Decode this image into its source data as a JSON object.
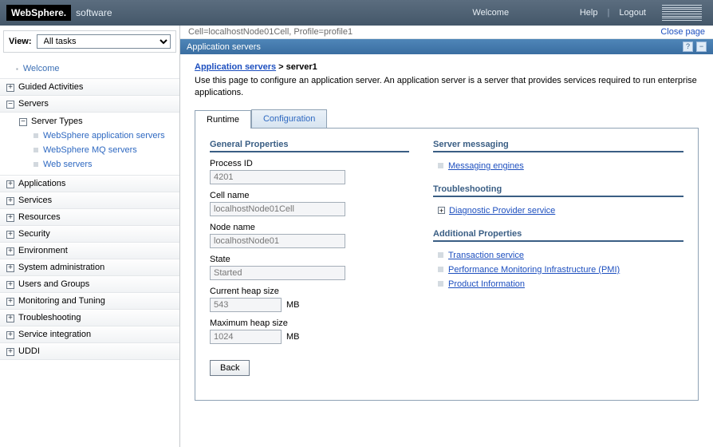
{
  "brand": {
    "strong": "WebSphere.",
    "suffix": "software"
  },
  "top": {
    "welcome": "Welcome",
    "help": "Help",
    "logout": "Logout"
  },
  "view": {
    "label": "View:",
    "value": "All tasks"
  },
  "nav": {
    "welcome": "Welcome",
    "guided": "Guided Activities",
    "servers": "Servers",
    "server_types": "Server Types",
    "was": "WebSphere application servers",
    "mq": "WebSphere MQ servers",
    "web": "Web servers",
    "applications": "Applications",
    "services": "Services",
    "resources": "Resources",
    "security": "Security",
    "environment": "Environment",
    "sysadmin": "System administration",
    "users": "Users and Groups",
    "monitoring": "Monitoring and Tuning",
    "troubleshooting": "Troubleshooting",
    "service_int": "Service integration",
    "uddi": "UDDI"
  },
  "path": "Cell=localhostNode01Cell, Profile=profile1",
  "close": "Close page",
  "panel_title": "Application servers",
  "crumb": {
    "link": "Application servers",
    "sep": " > ",
    "current": "server1"
  },
  "desc": "Use this page to configure an application server. An application server is a server that provides services required to run enterprise applications.",
  "tabs": {
    "runtime": "Runtime",
    "config": "Configuration"
  },
  "gp": {
    "title": "General Properties",
    "pid_l": "Process ID",
    "pid": "4201",
    "cell_l": "Cell name",
    "cell": "localhostNode01Cell",
    "node_l": "Node name",
    "node": "localhostNode01",
    "state_l": "State",
    "state": "Started",
    "cur_l": "Current heap size",
    "cur": "543",
    "max_l": "Maximum heap size",
    "max": "1024",
    "mb": "MB",
    "back": "Back"
  },
  "rs": {
    "msg_t": "Server messaging",
    "msg_link": "Messaging engines",
    "ts_t": "Troubleshooting",
    "ts_link": "Diagnostic Provider service",
    "ap_t": "Additional Properties",
    "ap1": "Transaction service",
    "ap2": "Performance Monitoring Infrastructure (PMI)",
    "ap3": "Product Information"
  }
}
